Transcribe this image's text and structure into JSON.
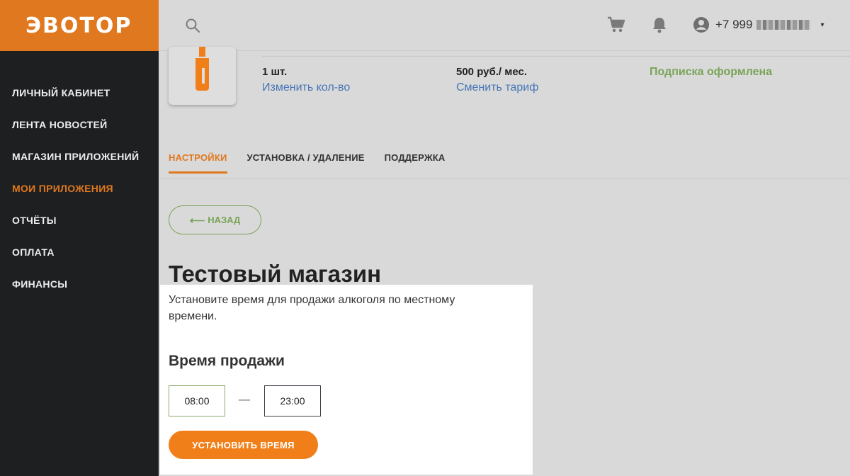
{
  "brand": {
    "logo_text": "ЭВОТОР",
    "accent": "#e0781f"
  },
  "header": {
    "phone_prefix": "+7 999",
    "caret": "▾"
  },
  "sidebar": {
    "items": [
      {
        "label": "ЛИЧНЫЙ КАБИНЕТ"
      },
      {
        "label": "ЛЕНТА НОВОСТЕЙ"
      },
      {
        "label": "МАГАЗИН ПРИЛОЖЕНИЙ"
      },
      {
        "label": "МОИ ПРИЛОЖЕНИЯ",
        "active": true
      },
      {
        "label": "ОТЧЁТЫ"
      },
      {
        "label": "ОПЛАТА"
      },
      {
        "label": "ФИНАНСЫ"
      }
    ]
  },
  "subscription": {
    "quantity": "1 шт.",
    "change_quantity": "Изменить кол-во",
    "price": "500 руб./ мес.",
    "change_tariff": "Сменить тариф",
    "status": "Подписка оформлена",
    "status_color": "#79a457"
  },
  "tabs": [
    {
      "label": "НАСТРОЙКИ",
      "active": true
    },
    {
      "label": "УСТАНОВКА / УДАЛЕНИЕ"
    },
    {
      "label": "ПОДДЕРЖКА"
    }
  ],
  "back_button": {
    "label": "НАЗАД",
    "arrow": "⟵"
  },
  "shop_title": "Тестовый магазин",
  "panel": {
    "description": "Установите время для продажи алкоголя по местному времени.",
    "heading": "Время продажи",
    "time_start": "08:00",
    "time_end": "23:00",
    "dash": "—",
    "submit_label": "УСТАНОВИТЬ ВРЕМЯ"
  },
  "icons": [
    "search-icon",
    "cart-icon",
    "bell-icon",
    "user-icon",
    "bottle-icon",
    "arrow-left-icon"
  ]
}
